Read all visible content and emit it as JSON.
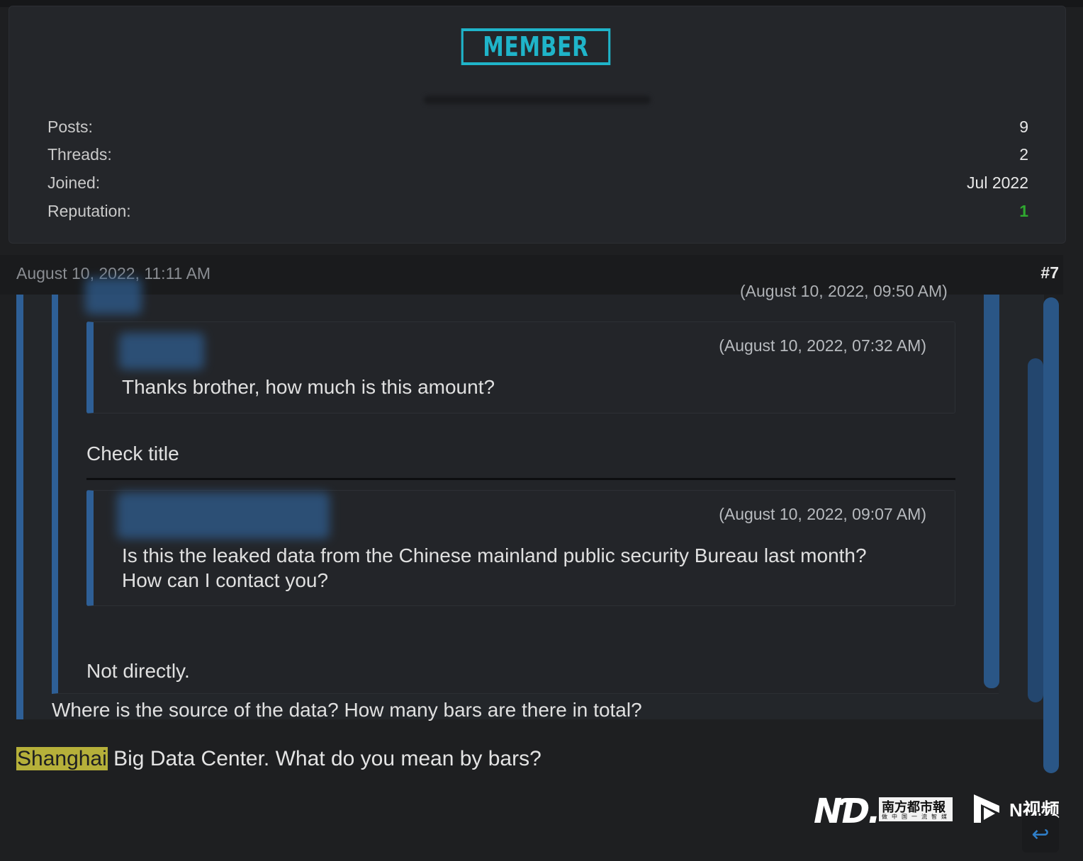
{
  "profile": {
    "rank_badge": "MEMBER",
    "stats": [
      {
        "label": "Posts:",
        "value": "9"
      },
      {
        "label": "Threads:",
        "value": "2"
      },
      {
        "label": "Joined:",
        "value": "Jul 2022"
      },
      {
        "label": "Reputation:",
        "value": "1"
      }
    ],
    "colors": {
      "badge": "#1fb4c9",
      "reputation": "#2fa82f",
      "quote_border": "#2e5f96"
    }
  },
  "post": {
    "date": "August 10, 2022, 11:11 AM",
    "number": "#7",
    "quotes": {
      "clipped_date": "(August 10, 2022, 09:50 AM)",
      "first": {
        "date": "(August 10, 2022, 07:32 AM)",
        "text": "Thanks brother, how much is this amount?"
      },
      "check_title": "Check title",
      "second": {
        "date": "(August 10, 2022, 09:07 AM)",
        "line1": "Is this the leaked data from the Chinese mainland public security Bureau last month?",
        "line2": "How can I contact you?"
      },
      "not_directly": "Not directly.",
      "question": "Where is the source of the data? How many bars are there in total?"
    },
    "answer": {
      "highlight": "Shanghai",
      "rest": " Big Data Center. What do you mean by bars?"
    }
  },
  "watermark": {
    "nd_logo": "NƊ.",
    "paper_name": "南方都市報",
    "paper_sub": "做中国一流智媒",
    "video_label": "N视频"
  },
  "icons": {
    "reply": "reply-arrow-icon",
    "play": "play-logo-icon"
  }
}
